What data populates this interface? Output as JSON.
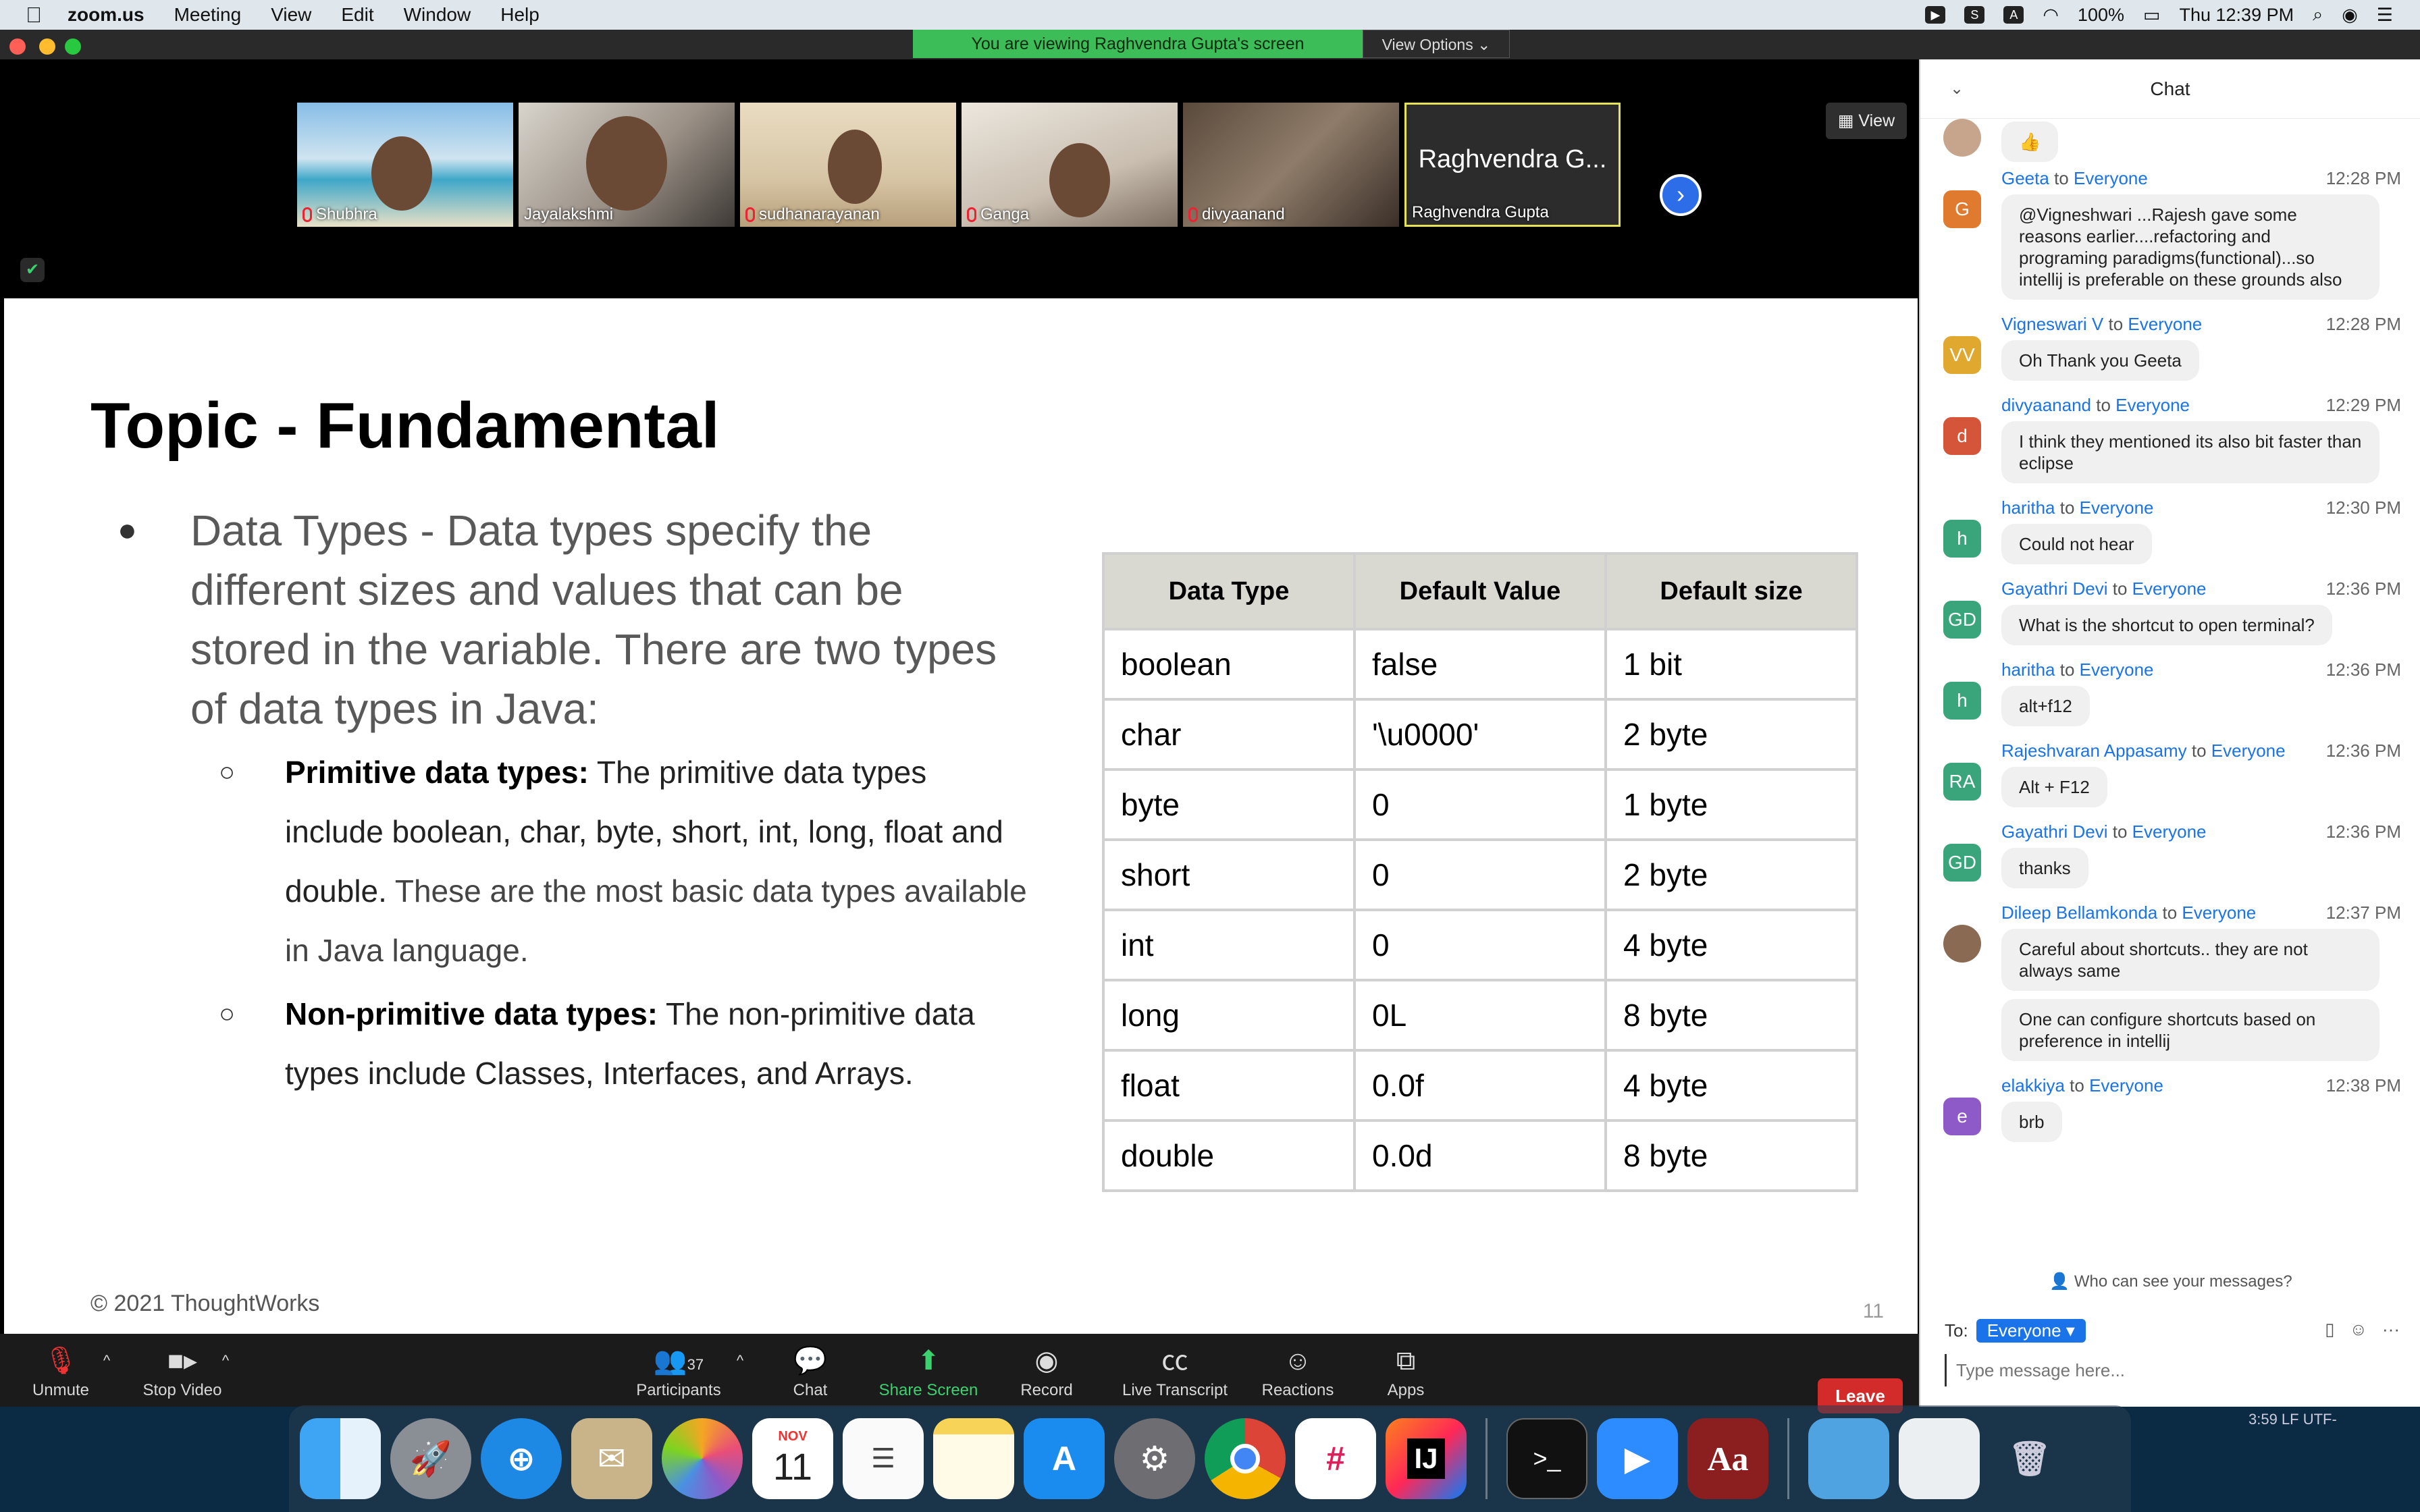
{
  "menubar": {
    "apple": "",
    "app": "zoom.us",
    "items": [
      "Meeting",
      "View",
      "Edit",
      "Window",
      "Help"
    ],
    "battery": "100%",
    "clock": "Thu 12:39 PM"
  },
  "banner": {
    "viewing": "You are viewing Raghvendra Gupta's screen",
    "view_options": "View Options ⌄"
  },
  "gallery": {
    "participants": [
      "Shubhra",
      "Jayalakshmi",
      "sudhanarayanan",
      "Ganga",
      "divyaanand",
      "Raghvendra Gupta"
    ],
    "speaker_big": "Raghvendra G...",
    "view_label": "View"
  },
  "slide": {
    "title": "Topic - Fundamental",
    "bullet_main": "Data Types - Data types specify the different sizes and values that can be stored in the variable. There are two types of data types in Java:",
    "sub1_bold": "Primitive data types:",
    "sub1_text_a": " The primitive data types include boolean, char, byte, short, int, long, float and double.",
    "sub1_text_b": " These are the most basic data types available in Java language.",
    "sub2_bold": "Non-primitive data types:",
    "sub2_text": " The non-primitive data types include Classes, Interfaces, and Arrays.",
    "table_headers": [
      "Data Type",
      "Default Value",
      "Default size"
    ],
    "table_rows": [
      [
        "boolean",
        "false",
        "1 bit"
      ],
      [
        "char",
        "'\\u0000'",
        "2 byte"
      ],
      [
        "byte",
        "0",
        "1 byte"
      ],
      [
        "short",
        "0",
        "2 byte"
      ],
      [
        "int",
        "0",
        "4 byte"
      ],
      [
        "long",
        "0L",
        "8 byte"
      ],
      [
        "float",
        "0.0f",
        "4 byte"
      ],
      [
        "double",
        "0.0d",
        "8 byte"
      ]
    ],
    "copyright": "© 2021 ThoughtWorks",
    "page": "11"
  },
  "toolbar": {
    "unmute": "Unmute",
    "stop_video": "Stop Video",
    "participants": "Participants",
    "participant_count": "37",
    "chat": "Chat",
    "share": "Share Screen",
    "record": "Record",
    "transcript": "Live Transcript",
    "reactions": "Reactions",
    "apps": "Apps",
    "leave": "Leave"
  },
  "chat": {
    "title": "Chat",
    "first_bubble": "👍",
    "messages": [
      {
        "from": "Geeta",
        "to": "Everyone",
        "time": "12:28 PM",
        "initials": "G",
        "text": "@Vigneshwari ...Rajesh gave some reasons earlier....refactoring and programing paradigms(functional)...so intellij is preferable on these grounds also"
      },
      {
        "from": "Vigneswari V",
        "to": "Everyone",
        "time": "12:28 PM",
        "initials": "VV",
        "text": "Oh Thank you Geeta"
      },
      {
        "from": "divyaanand",
        "to": "Everyone",
        "time": "12:29 PM",
        "initials": "d",
        "text": "I think they mentioned its also bit faster than eclipse"
      },
      {
        "from": "haritha",
        "to": "Everyone",
        "time": "12:30 PM",
        "initials": "h",
        "text": "Could not hear"
      },
      {
        "from": "Gayathri Devi",
        "to": "Everyone",
        "time": "12:36 PM",
        "initials": "GD",
        "text": "What is the shortcut to open terminal?"
      },
      {
        "from": "haritha",
        "to": "Everyone",
        "time": "12:36 PM",
        "initials": "h",
        "text": "alt+f12"
      },
      {
        "from": "Rajeshvaran Appasamy",
        "to": "Everyone",
        "time": "12:36 PM",
        "initials": "RA",
        "text": "Alt + F12"
      },
      {
        "from": "Gayathri Devi",
        "to": "Everyone",
        "time": "12:36 PM",
        "initials": "GD",
        "text": "thanks"
      },
      {
        "from": "Dileep Bellamkonda",
        "to": "Everyone",
        "time": "12:37 PM",
        "initials": "",
        "text": "Careful about shortcuts.. they are not always same",
        "text2": "One can configure shortcuts based on preference in intellij"
      },
      {
        "from": "elakkiya",
        "to": "Everyone",
        "time": "12:38 PM",
        "initials": "e",
        "text": "brb"
      }
    ],
    "to_word": "to",
    "who_can_see": "Who can see your messages?",
    "to_label": "To:",
    "to_value": "Everyone ▾",
    "input_placeholder": "Type message here..."
  },
  "status_strip": "3:59   LF   UTF-",
  "dock": {
    "calendar_month": "NOV",
    "calendar_day": "11",
    "terminal": ">_",
    "intellij": "IJ",
    "dictionary": "Aa"
  }
}
